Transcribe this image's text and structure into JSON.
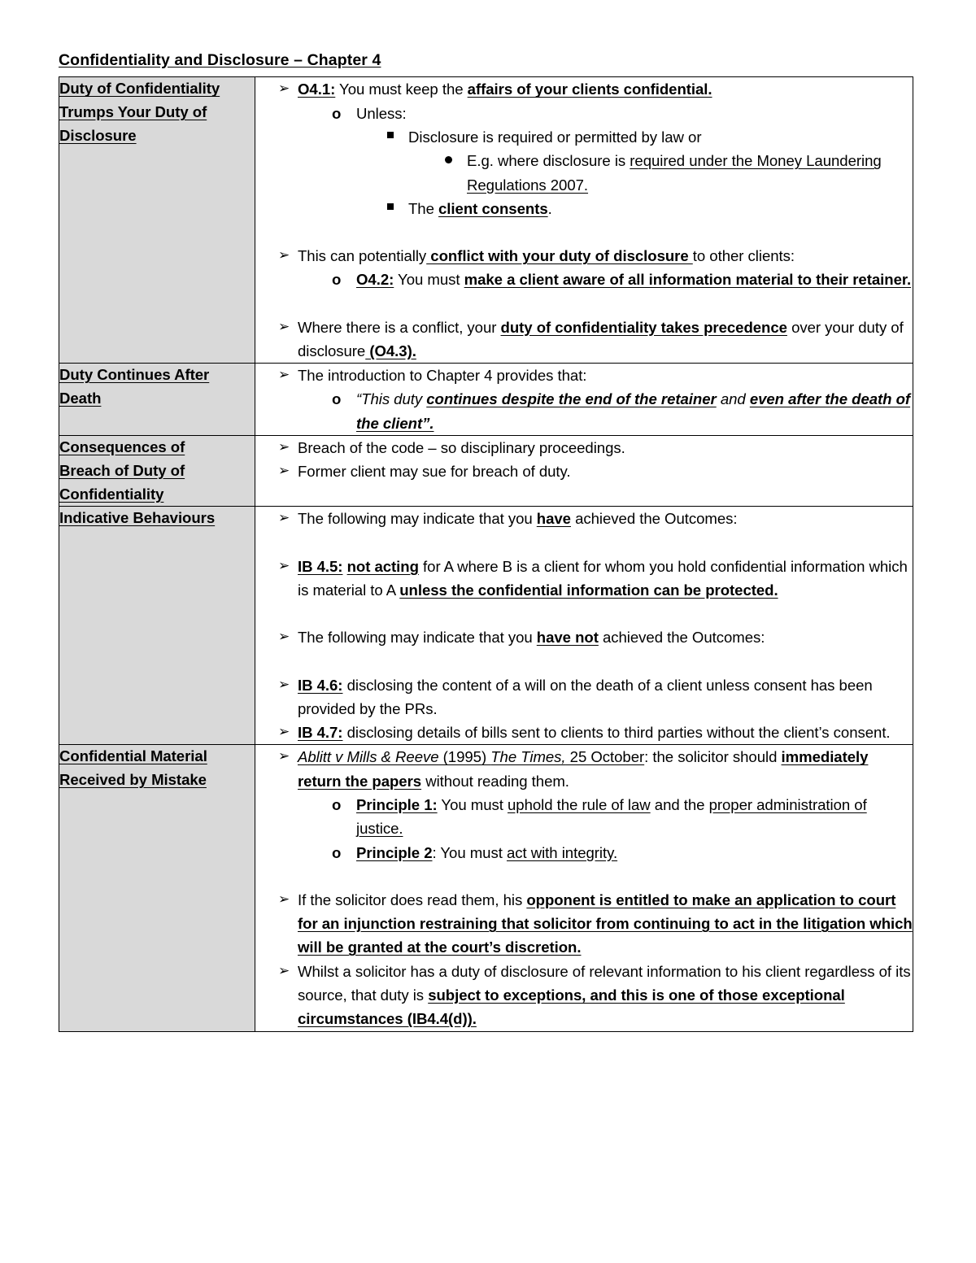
{
  "document": {
    "title": "Confidentiality and Disclosure – Chapter 4"
  },
  "bullets": {
    "level1": "➢",
    "level2": "o",
    "level3": "square",
    "level4": "dot"
  },
  "colors": {
    "category_background": "#d9d9d9",
    "border": "#000000",
    "text": "#000000",
    "page_background": "#ffffff"
  },
  "table": {
    "rows": [
      {
        "category": "Duty of Confidentiality Trumps Your Duty of Disclosure",
        "category_lines": [
          "Duty of Confidentiality ",
          "Trumps Your Duty of ",
          "Disclosure"
        ],
        "items": [
          {
            "level": 1,
            "runs": [
              {
                "text": "O4.1:",
                "style": "bold-underline"
              },
              {
                "text": " You must keep the ",
                "style": "plain"
              },
              {
                "text": "affairs of your clients confidential.",
                "style": "bold-underline"
              }
            ]
          },
          {
            "level": 2,
            "runs": [
              {
                "text": "Unless:",
                "style": "plain"
              }
            ]
          },
          {
            "level": 3,
            "runs": [
              {
                "text": "Disclosure is required or permitted by law or",
                "style": "plain"
              }
            ]
          },
          {
            "level": 4,
            "runs": [
              {
                "text": "E.g. where disclosure is ",
                "style": "plain"
              },
              {
                "text": "required under the Money Laundering Regulations 2007.",
                "style": "underline"
              }
            ]
          },
          {
            "level": 3,
            "runs": [
              {
                "text": "The ",
                "style": "plain"
              },
              {
                "text": "client consents",
                "style": "bold-underline"
              },
              {
                "text": ".",
                "style": "plain"
              }
            ]
          },
          {
            "level": 1,
            "spacing": "before",
            "runs": [
              {
                "text": "This can potentially",
                "style": "plain"
              },
              {
                "text": " conflict with your duty of disclosure ",
                "style": "bold-underline"
              },
              {
                "text": "to other clients:",
                "style": "plain"
              }
            ]
          },
          {
            "level": 2,
            "runs": [
              {
                "text": "O4.2:",
                "style": "bold-underline"
              },
              {
                "text": " You must ",
                "style": "plain"
              },
              {
                "text": "make a client aware of all information material to their retainer.",
                "style": "bold-underline"
              }
            ]
          },
          {
            "level": 1,
            "spacing": "before",
            "runs": [
              {
                "text": "Where there is a conflict, your ",
                "style": "plain"
              },
              {
                "text": "duty of confidentiality takes precedence",
                "style": "bold-underline"
              },
              {
                "text": " over your duty of disclosure",
                "style": "plain"
              },
              {
                "text": " (O4.3).",
                "style": "bold-underline"
              }
            ]
          }
        ]
      },
      {
        "category": "Duty Continues After Death",
        "category_lines": [
          "Duty Continues After ",
          "Death"
        ],
        "items": [
          {
            "level": 1,
            "runs": [
              {
                "text": "The introduction to Chapter 4 provides that:",
                "style": "plain"
              }
            ]
          },
          {
            "level": 2,
            "runs": [
              {
                "text": "“This duty ",
                "style": "italic"
              },
              {
                "text": "continues despite the end of the retainer",
                "style": "bold-italic-underline"
              },
              {
                "text": " and ",
                "style": "italic"
              },
              {
                "text": "even after the death of the client”.",
                "style": "bold-italic-underline"
              }
            ]
          }
        ]
      },
      {
        "category": "Consequences of Breach of Duty of Confidentiality",
        "category_lines": [
          "Consequences of ",
          "Breach of Duty of ",
          "Confidentiality"
        ],
        "items": [
          {
            "level": 1,
            "runs": [
              {
                "text": "Breach of the code – so disciplinary proceedings.",
                "style": "plain"
              }
            ]
          },
          {
            "level": 1,
            "runs": [
              {
                "text": "Former client may sue for breach of duty.",
                "style": "plain"
              }
            ]
          }
        ]
      },
      {
        "category": "Indicative Behaviours",
        "category_lines": [
          "Indicative Behaviours"
        ],
        "items": [
          {
            "level": 1,
            "runs": [
              {
                "text": "The following may indicate that you ",
                "style": "plain"
              },
              {
                "text": "have",
                "style": "bold-underline"
              },
              {
                "text": " achieved the Outcomes:",
                "style": "plain"
              }
            ]
          },
          {
            "level": 1,
            "spacing": "before",
            "runs": [
              {
                "text": "IB 4.5:",
                "style": "bold-underline"
              },
              {
                "text": " ",
                "style": "plain"
              },
              {
                "text": "not acting",
                "style": "bold-underline"
              },
              {
                "text": " for A where B is a client for whom you hold confidential information which is material to A ",
                "style": "plain"
              },
              {
                "text": "unless the confidential information can be protected.",
                "style": "bold-underline"
              }
            ]
          },
          {
            "level": 1,
            "spacing": "before",
            "runs": [
              {
                "text": "The following may indicate that you ",
                "style": "plain"
              },
              {
                "text": "have not",
                "style": "bold-underline"
              },
              {
                "text": " achieved the Outcomes:",
                "style": "plain"
              }
            ]
          },
          {
            "level": 1,
            "spacing": "before",
            "runs": [
              {
                "text": "IB 4.6:",
                "style": "bold-underline"
              },
              {
                "text": " disclosing the content of a will on the death of a client unless consent has been provided by the PRs.",
                "style": "plain"
              }
            ]
          },
          {
            "level": 1,
            "runs": [
              {
                "text": "IB 4.7:",
                "style": "bold-underline"
              },
              {
                "text": " disclosing details of bills sent to clients to third parties without the client’s consent.",
                "style": "plain"
              }
            ]
          }
        ]
      },
      {
        "category": "Confidential Material Received by Mistake",
        "category_lines": [
          "Confidential Material ",
          "Received by Mistake"
        ],
        "items": [
          {
            "level": 1,
            "runs": [
              {
                "text": "Ablitt v Mills & Reeve",
                "style": "italic-underline"
              },
              {
                "text": " (1995) ",
                "style": "underline"
              },
              {
                "text": "The Times,",
                "style": "italic-underline"
              },
              {
                "text": " 25 October",
                "style": "underline"
              },
              {
                "text": ": the solicitor should ",
                "style": "plain"
              },
              {
                "text": "immediately return the papers",
                "style": "bold-underline"
              },
              {
                "text": " without reading them.",
                "style": "plain"
              }
            ]
          },
          {
            "level": 2,
            "runs": [
              {
                "text": "Principle 1:",
                "style": "bold-underline"
              },
              {
                "text": " You must ",
                "style": "plain"
              },
              {
                "text": "uphold the rule of law",
                "style": "underline"
              },
              {
                "text": " and the ",
                "style": "plain"
              },
              {
                "text": "proper administration of justice.",
                "style": "underline"
              }
            ]
          },
          {
            "level": 2,
            "runs": [
              {
                "text": "Principle 2",
                "style": "bold-underline"
              },
              {
                "text": ": You must ",
                "style": "plain"
              },
              {
                "text": "act with integrity.",
                "style": "underline"
              }
            ]
          },
          {
            "level": 1,
            "spacing": "before",
            "runs": [
              {
                "text": "If the solicitor does read them, his ",
                "style": "plain"
              },
              {
                "text": "opponent is entitled to make an application to court for an injunction restraining that solicitor from continuing to act in the litigation which will be granted at the court’s discretion.",
                "style": "bold-underline"
              }
            ]
          },
          {
            "level": 1,
            "runs": [
              {
                "text": "Whilst a solicitor has a duty of disclosure of relevant information to his client regardless of its source, that duty is ",
                "style": "plain"
              },
              {
                "text": "subject to exceptions, and this is one of those exceptional circumstances (IB4.4(d)).",
                "style": "bold-underline"
              }
            ]
          }
        ]
      }
    ]
  }
}
